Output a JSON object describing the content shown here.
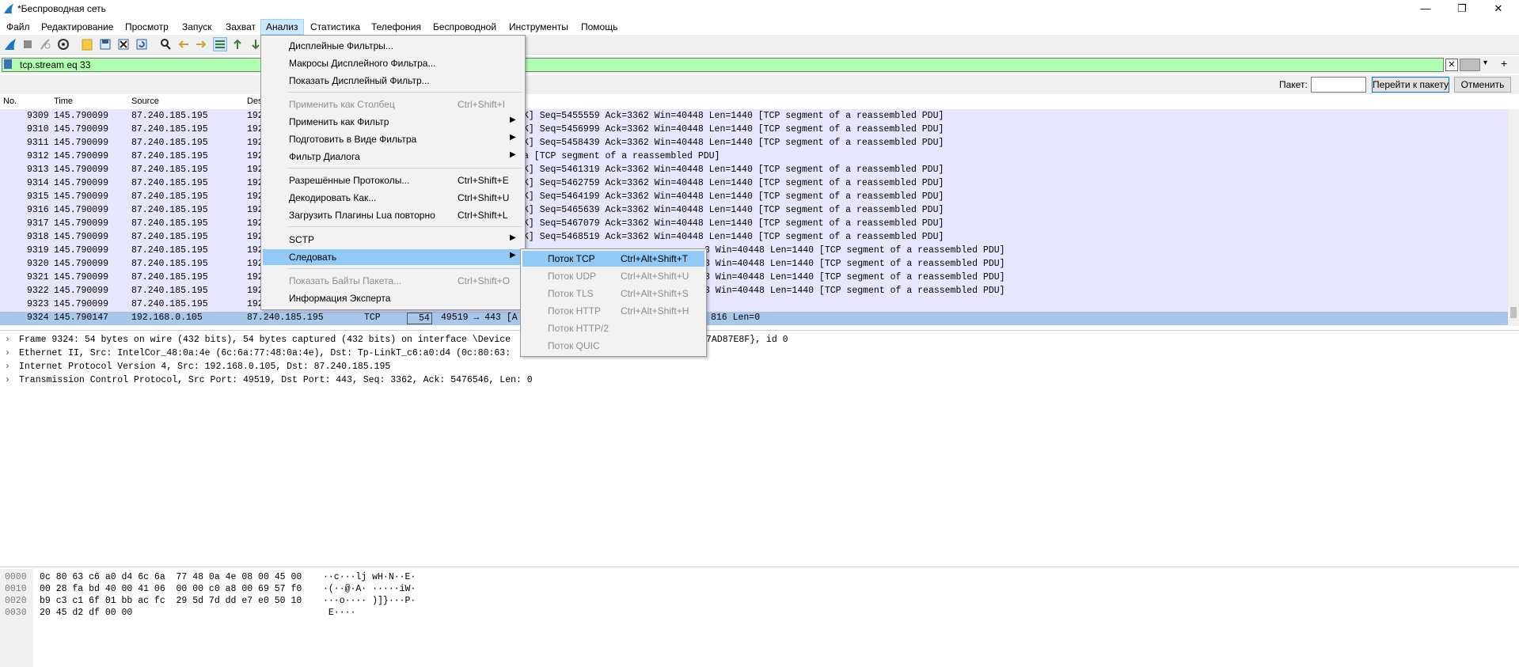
{
  "window": {
    "title": "*Беспроводная сеть",
    "min": "—",
    "max": "❐",
    "close": "✕"
  },
  "menubar": [
    "Файл",
    "Редактирование",
    "Просмотр",
    "Запуск",
    "Захват",
    "Анализ",
    "Статистика",
    "Телефония",
    "Беспроводной",
    "Инструменты",
    "Помощь"
  ],
  "filter": {
    "value": "tcp.stream eq 33"
  },
  "goto": {
    "label": "Пакет:",
    "go_button": "Перейти к пакету",
    "cancel_button": "Отменить"
  },
  "packet_list": {
    "columns": [
      "No.",
      "Time",
      "Source",
      "Des"
    ],
    "rows": [
      {
        "no": "9309",
        "time": "145.790099",
        "src": "87.240.185.195",
        "dst": "192",
        "tail": "K] Seq=5455559 Ack=3362 Win=40448 Len=1440 [TCP segment of a reassembled PDU]"
      },
      {
        "no": "9310",
        "time": "145.790099",
        "src": "87.240.185.195",
        "dst": "192",
        "tail": "K] Seq=5456999 Ack=3362 Win=40448 Len=1440 [TCP segment of a reassembled PDU]"
      },
      {
        "no": "9311",
        "time": "145.790099",
        "src": "87.240.185.195",
        "dst": "192",
        "tail": "K] Seq=5458439 Ack=3362 Win=40448 Len=1440 [TCP segment of a reassembled PDU]"
      },
      {
        "no": "9312",
        "time": "145.790099",
        "src": "87.240.185.195",
        "dst": "192",
        "tail": "a [TCP segment of a reassembled PDU]"
      },
      {
        "no": "9313",
        "time": "145.790099",
        "src": "87.240.185.195",
        "dst": "192",
        "tail": "K] Seq=5461319 Ack=3362 Win=40448 Len=1440 [TCP segment of a reassembled PDU]"
      },
      {
        "no": "9314",
        "time": "145.790099",
        "src": "87.240.185.195",
        "dst": "192",
        "tail": "K] Seq=5462759 Ack=3362 Win=40448 Len=1440 [TCP segment of a reassembled PDU]"
      },
      {
        "no": "9315",
        "time": "145.790099",
        "src": "87.240.185.195",
        "dst": "192",
        "tail": "K] Seq=5464199 Ack=3362 Win=40448 Len=1440 [TCP segment of a reassembled PDU]"
      },
      {
        "no": "9316",
        "time": "145.790099",
        "src": "87.240.185.195",
        "dst": "192",
        "tail": "K] Seq=5465639 Ack=3362 Win=40448 Len=1440 [TCP segment of a reassembled PDU]"
      },
      {
        "no": "9317",
        "time": "145.790099",
        "src": "87.240.185.195",
        "dst": "192",
        "tail": "K] Seq=5467079 Ack=3362 Win=40448 Len=1440 [TCP segment of a reassembled PDU]"
      },
      {
        "no": "9318",
        "time": "145.790099",
        "src": "87.240.185.195",
        "dst": "192",
        "tail": "K] Seq=5468519 Ack=3362 Win=40448 Len=1440 [TCP segment of a reassembled PDU]"
      },
      {
        "no": "9319",
        "time": "145.790099",
        "src": "87.240.185.195",
        "dst": "192",
        "tail": "3 Win=40448 Len=1440 [TCP segment of a reassembled PDU]"
      },
      {
        "no": "9320",
        "time": "145.790099",
        "src": "87.240.185.195",
        "dst": "192",
        "tail": "3 Win=40448 Len=1440 [TCP segment of a reassembled PDU]"
      },
      {
        "no": "9321",
        "time": "145.790099",
        "src": "87.240.185.195",
        "dst": "192",
        "tail": "3 Win=40448 Len=1440 [TCP segment of a reassembled PDU]"
      },
      {
        "no": "9322",
        "time": "145.790099",
        "src": "87.240.185.195",
        "dst": "192",
        "tail": "3 Win=40448 Len=1440 [TCP segment of a reassembled PDU]"
      },
      {
        "no": "9323",
        "time": "145.790099",
        "src": "87.240.185.195",
        "dst": "192",
        "tail": ""
      }
    ],
    "selected": {
      "no": "9324",
      "time": "145.790147",
      "src": "192.168.0.105",
      "dst": "87.240.185.195",
      "proto": "TCP",
      "len": "54",
      "info": "49519 → 443 [A",
      "tail": "816 Len=0"
    }
  },
  "details": [
    {
      "text": "Frame 9324: 54 bytes on wire (432 bits), 54 bytes captured (432 bits) on interface \\Device",
      "tail": "7AD87E8F}, id 0"
    },
    {
      "text": "Ethernet II, Src: IntelCor_48:0a:4e (6c:6a:77:48:0a:4e), Dst: Tp-LinkT_c6:a0:d4 (0c:80:63:",
      "tail": ""
    },
    {
      "text": "Internet Protocol Version 4, Src: 192.168.0.105, Dst: 87.240.185.195",
      "tail": ""
    },
    {
      "text": "Transmission Control Protocol, Src Port: 49519, Dst Port: 443, Seq: 3362, Ack: 5476546, Len: 0",
      "tail": ""
    }
  ],
  "bytes": [
    {
      "off": "0000",
      "hex": "0c 80 63 c6 a0 d4 6c 6a  77 48 0a 4e 08 00 45 00",
      "asc": "··c···lj wH·N··E·"
    },
    {
      "off": "0010",
      "hex": "00 28 fa bd 40 00 41 06  00 00 c0 a8 00 69 57 f0",
      "asc": "·(··@·A· ·····iW·"
    },
    {
      "off": "0020",
      "hex": "b9 c3 c1 6f 01 bb ac fc  29 5d 7d dd e7 e0 50 10",
      "asc": "···o···· )]}···P·"
    },
    {
      "off": "0030",
      "hex": "20 45 d2 df 00 00",
      "asc": " E····"
    }
  ],
  "analysis_menu": {
    "items": [
      {
        "label": "Дисплейные Фильтры...",
        "shortcut": "",
        "disabled": false,
        "submenu": false
      },
      {
        "label": "Макросы Дисплейного Фильтра...",
        "shortcut": "",
        "disabled": false,
        "submenu": false
      },
      {
        "label": "Показать Дисплейный Фильтр...",
        "shortcut": "",
        "disabled": false,
        "submenu": false
      },
      {
        "label": "Применить как Столбец",
        "shortcut": "Ctrl+Shift+I",
        "disabled": true,
        "submenu": false
      },
      {
        "label": "Применить как Фильтр",
        "shortcut": "",
        "disabled": false,
        "submenu": true
      },
      {
        "label": "Подготовить в Виде Фильтра",
        "shortcut": "",
        "disabled": false,
        "submenu": true
      },
      {
        "label": "Фильтр Диалога",
        "shortcut": "",
        "disabled": false,
        "submenu": true
      },
      {
        "label": "Разрешённые Протоколы...",
        "shortcut": "Ctrl+Shift+E",
        "disabled": false,
        "submenu": false
      },
      {
        "label": "Декодировать Как...",
        "shortcut": "Ctrl+Shift+U",
        "disabled": false,
        "submenu": false
      },
      {
        "label": "Загрузить Плагины Lua повторно",
        "shortcut": "Ctrl+Shift+L",
        "disabled": false,
        "submenu": false
      },
      {
        "label": "SCTP",
        "shortcut": "",
        "disabled": false,
        "submenu": true
      },
      {
        "label": "Следовать",
        "shortcut": "",
        "disabled": false,
        "submenu": true
      },
      {
        "label": "Показать Байты Пакета...",
        "shortcut": "Ctrl+Shift+O",
        "disabled": true,
        "submenu": false
      },
      {
        "label": "Информация Эксперта",
        "shortcut": "",
        "disabled": false,
        "submenu": false
      }
    ]
  },
  "follow_menu": {
    "items": [
      {
        "label": "Поток TCP",
        "shortcut": "Ctrl+Alt+Shift+T",
        "disabled": false
      },
      {
        "label": "Поток UDP",
        "shortcut": "Ctrl+Alt+Shift+U",
        "disabled": true
      },
      {
        "label": "Поток TLS",
        "shortcut": "Ctrl+Alt+Shift+S",
        "disabled": true
      },
      {
        "label": "Поток HTTP",
        "shortcut": "Ctrl+Alt+Shift+H",
        "disabled": true
      },
      {
        "label": "Поток HTTP/2",
        "shortcut": "",
        "disabled": true
      },
      {
        "label": "Поток QUIC",
        "shortcut": "",
        "disabled": true
      }
    ]
  },
  "colors": {
    "filter_ok": "#afffaf",
    "row_tcp": "#e7e6ff",
    "row_selected": "#a9c7ea",
    "menu_highlight": "#91c9f7"
  },
  "icons": [
    "shark-fin-icon",
    "stop-icon",
    "restart-icon",
    "options-gear-icon",
    "open-file-icon",
    "save-icon",
    "close-file-icon",
    "reload-icon",
    "find-icon",
    "back-arrow-icon",
    "forward-arrow-icon",
    "go-to-packet-icon",
    "first-packet-icon",
    "last-packet-icon",
    "bookmark-icon",
    "clear-filter-icon",
    "apply-filter-arrow-icon",
    "filter-history-dropdown-icon",
    "add-filter-plus-icon",
    "chevron-right-icon"
  ]
}
